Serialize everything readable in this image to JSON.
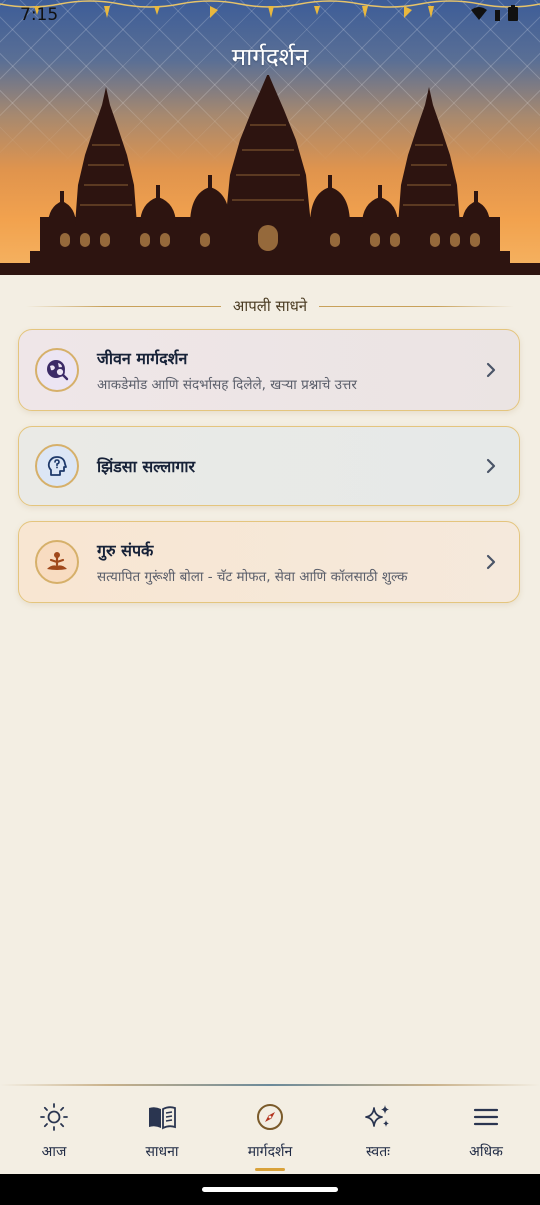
{
  "status_bar": {
    "time": "7:15"
  },
  "header": {
    "title": "मार्गदर्शन"
  },
  "section": {
    "title": "आपली साधने"
  },
  "cards": [
    {
      "title": "जीवन मार्गदर्शन",
      "subtitle": "आकडेमोड आणि संदर्भासह दिलेले, खऱ्या प्रश्नाचे उत्तर",
      "icon": "globe-search-icon"
    },
    {
      "title": "झिंडसा सल्लागार",
      "subtitle": "",
      "icon": "head-question-icon"
    },
    {
      "title": "गुरु संपर्क",
      "subtitle": "सत्यापित गुरूंशी बोला - चॅट मोफत, सेवा आणि कॉलसाठी शुल्क",
      "icon": "meditation-icon"
    }
  ],
  "bottom_nav": {
    "items": [
      {
        "label": "आज",
        "icon": "sun-icon"
      },
      {
        "label": "साधना",
        "icon": "book-icon"
      },
      {
        "label": "मार्गदर्शन",
        "icon": "compass-icon",
        "active": true
      },
      {
        "label": "स्वतः",
        "icon": "sparkles-icon"
      },
      {
        "label": "अधिक",
        "icon": "menu-icon"
      }
    ]
  },
  "colors": {
    "accent": "#d9a23a",
    "card_border": "#e4c57e",
    "background": "#f3eee3"
  }
}
